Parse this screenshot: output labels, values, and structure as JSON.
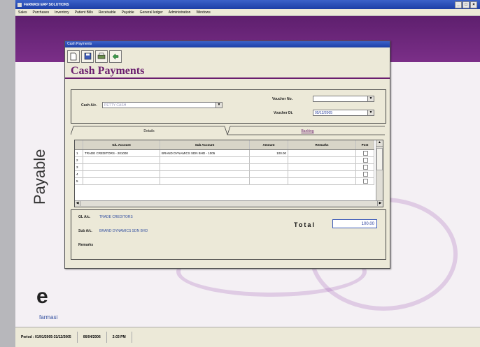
{
  "window": {
    "title": "FARMASI ERP SOLUTIONS",
    "controls": [
      "_",
      "□",
      "×"
    ]
  },
  "menu": [
    "Sales",
    "Purchases",
    "Inventory",
    "Patient Bills",
    "Receivable",
    "Payable",
    "General ledger",
    "Administration",
    "Windows"
  ],
  "dialog": {
    "title": "Cash Payments",
    "heading": "Cash Payments"
  },
  "toolbar": {
    "new_icon": "new-document-icon",
    "save_icon": "save-icon",
    "print_icon": "print-icon",
    "exit_icon": "exit-icon"
  },
  "form": {
    "cash_ac_label": "Cash A/c.",
    "cash_ac_value": "PETTY CASH",
    "voucher_no_label": "Voucher No.",
    "voucher_no_value": "",
    "voucher_dt_label": "Voucher Dt.",
    "voucher_dt_value": "05/12/2005"
  },
  "tabs": {
    "details": "Details",
    "banking": "Banking"
  },
  "grid": {
    "columns": [
      "",
      "G/L Account",
      "Sub Account",
      "Amount",
      "Remarks",
      "Post"
    ],
    "rows": [
      {
        "no": "1",
        "gl": "TRADE CREDITORS - 201000",
        "sub": "BRAND DYNAMICS SDN BHD - 1005",
        "amount": "100.00",
        "remarks": ""
      },
      {
        "no": "2",
        "gl": "",
        "sub": "",
        "amount": "",
        "remarks": ""
      },
      {
        "no": "3",
        "gl": "",
        "sub": "",
        "amount": "",
        "remarks": ""
      },
      {
        "no": "4",
        "gl": "",
        "sub": "",
        "amount": "",
        "remarks": ""
      },
      {
        "no": "5",
        "gl": "",
        "sub": "",
        "amount": "",
        "remarks": ""
      }
    ]
  },
  "summary": {
    "gl_label": "GL A/c.",
    "gl_value": "TRADE CREDITORS",
    "sub_label": "Sub A/c.",
    "sub_value": "BRAND DYNAMICS SDN BHD",
    "remarks_label": "Remarks",
    "total_label": "Total",
    "total_value": "100.00"
  },
  "brand": {
    "side_text": "Payable",
    "logo_letter": "e",
    "logo_name": "farmasi"
  },
  "status": {
    "period": "Period : 01/01/2005-31/12/2005",
    "date": "06/04/2006",
    "time": "2:03 PM"
  },
  "colors": {
    "accent": "#6a1e6e",
    "titlebar": "#1d3fa6",
    "band": "#7b2f88"
  }
}
